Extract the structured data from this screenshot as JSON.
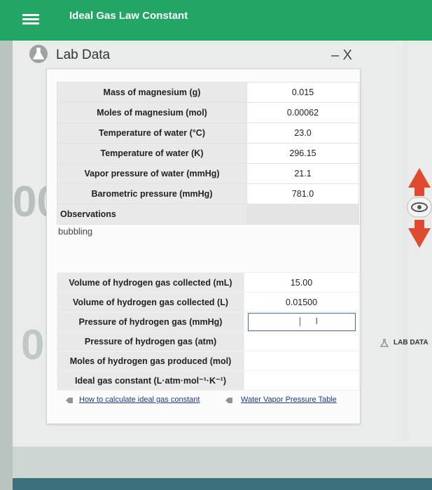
{
  "app": {
    "title": "Ideal Gas Law Constant"
  },
  "panel": {
    "title": "Lab Data",
    "controls": "– X"
  },
  "lab_rows": [
    {
      "label": "Mass of magnesium (g)",
      "value": "0.015"
    },
    {
      "label": "Moles of magnesium (mol)",
      "value": "0.00062"
    },
    {
      "label": "Temperature of water (°C)",
      "value": "23.0"
    },
    {
      "label": "Temperature of water (K)",
      "value": "296.15"
    },
    {
      "label": "Vapor pressure of water (mmHg)",
      "value": "21.1"
    },
    {
      "label": "Barometric pressure (mmHg)",
      "value": "781.0"
    }
  ],
  "observations": {
    "label": "Observations",
    "text": "bubbling"
  },
  "gas_rows": [
    {
      "label": "Volume of hydrogen gas collected (mL)",
      "value": "15.00"
    },
    {
      "label": "Volume of hydrogen gas collected (L)",
      "value": "0.01500"
    },
    {
      "label": "Pressure of hydrogen gas (mmHg)",
      "value": ""
    },
    {
      "label": "Pressure of hydrogen gas (atm)",
      "value": ""
    },
    {
      "label": "Moles of hydrogen gas produced (mol)",
      "value": ""
    },
    {
      "label": "Ideal gas constant (L·atm·mol⁻¹·K⁻¹)",
      "value": ""
    }
  ],
  "links": {
    "how_to": "How to calculate ideal gas constant",
    "water_table": "Water Vapor Pressure Table"
  },
  "side": {
    "lab_data": "LAB DATA"
  },
  "decor": {
    "left_top": "00",
    "left_bottom": "0"
  },
  "colors": {
    "topbar": "#22a565",
    "link": "#1b3a8a",
    "arrow": "#e04a2f"
  },
  "icons": [
    "menu-icon",
    "flask-icon",
    "tag-icon",
    "up-arrow-icon",
    "eye-icon",
    "down-arrow-icon"
  ]
}
